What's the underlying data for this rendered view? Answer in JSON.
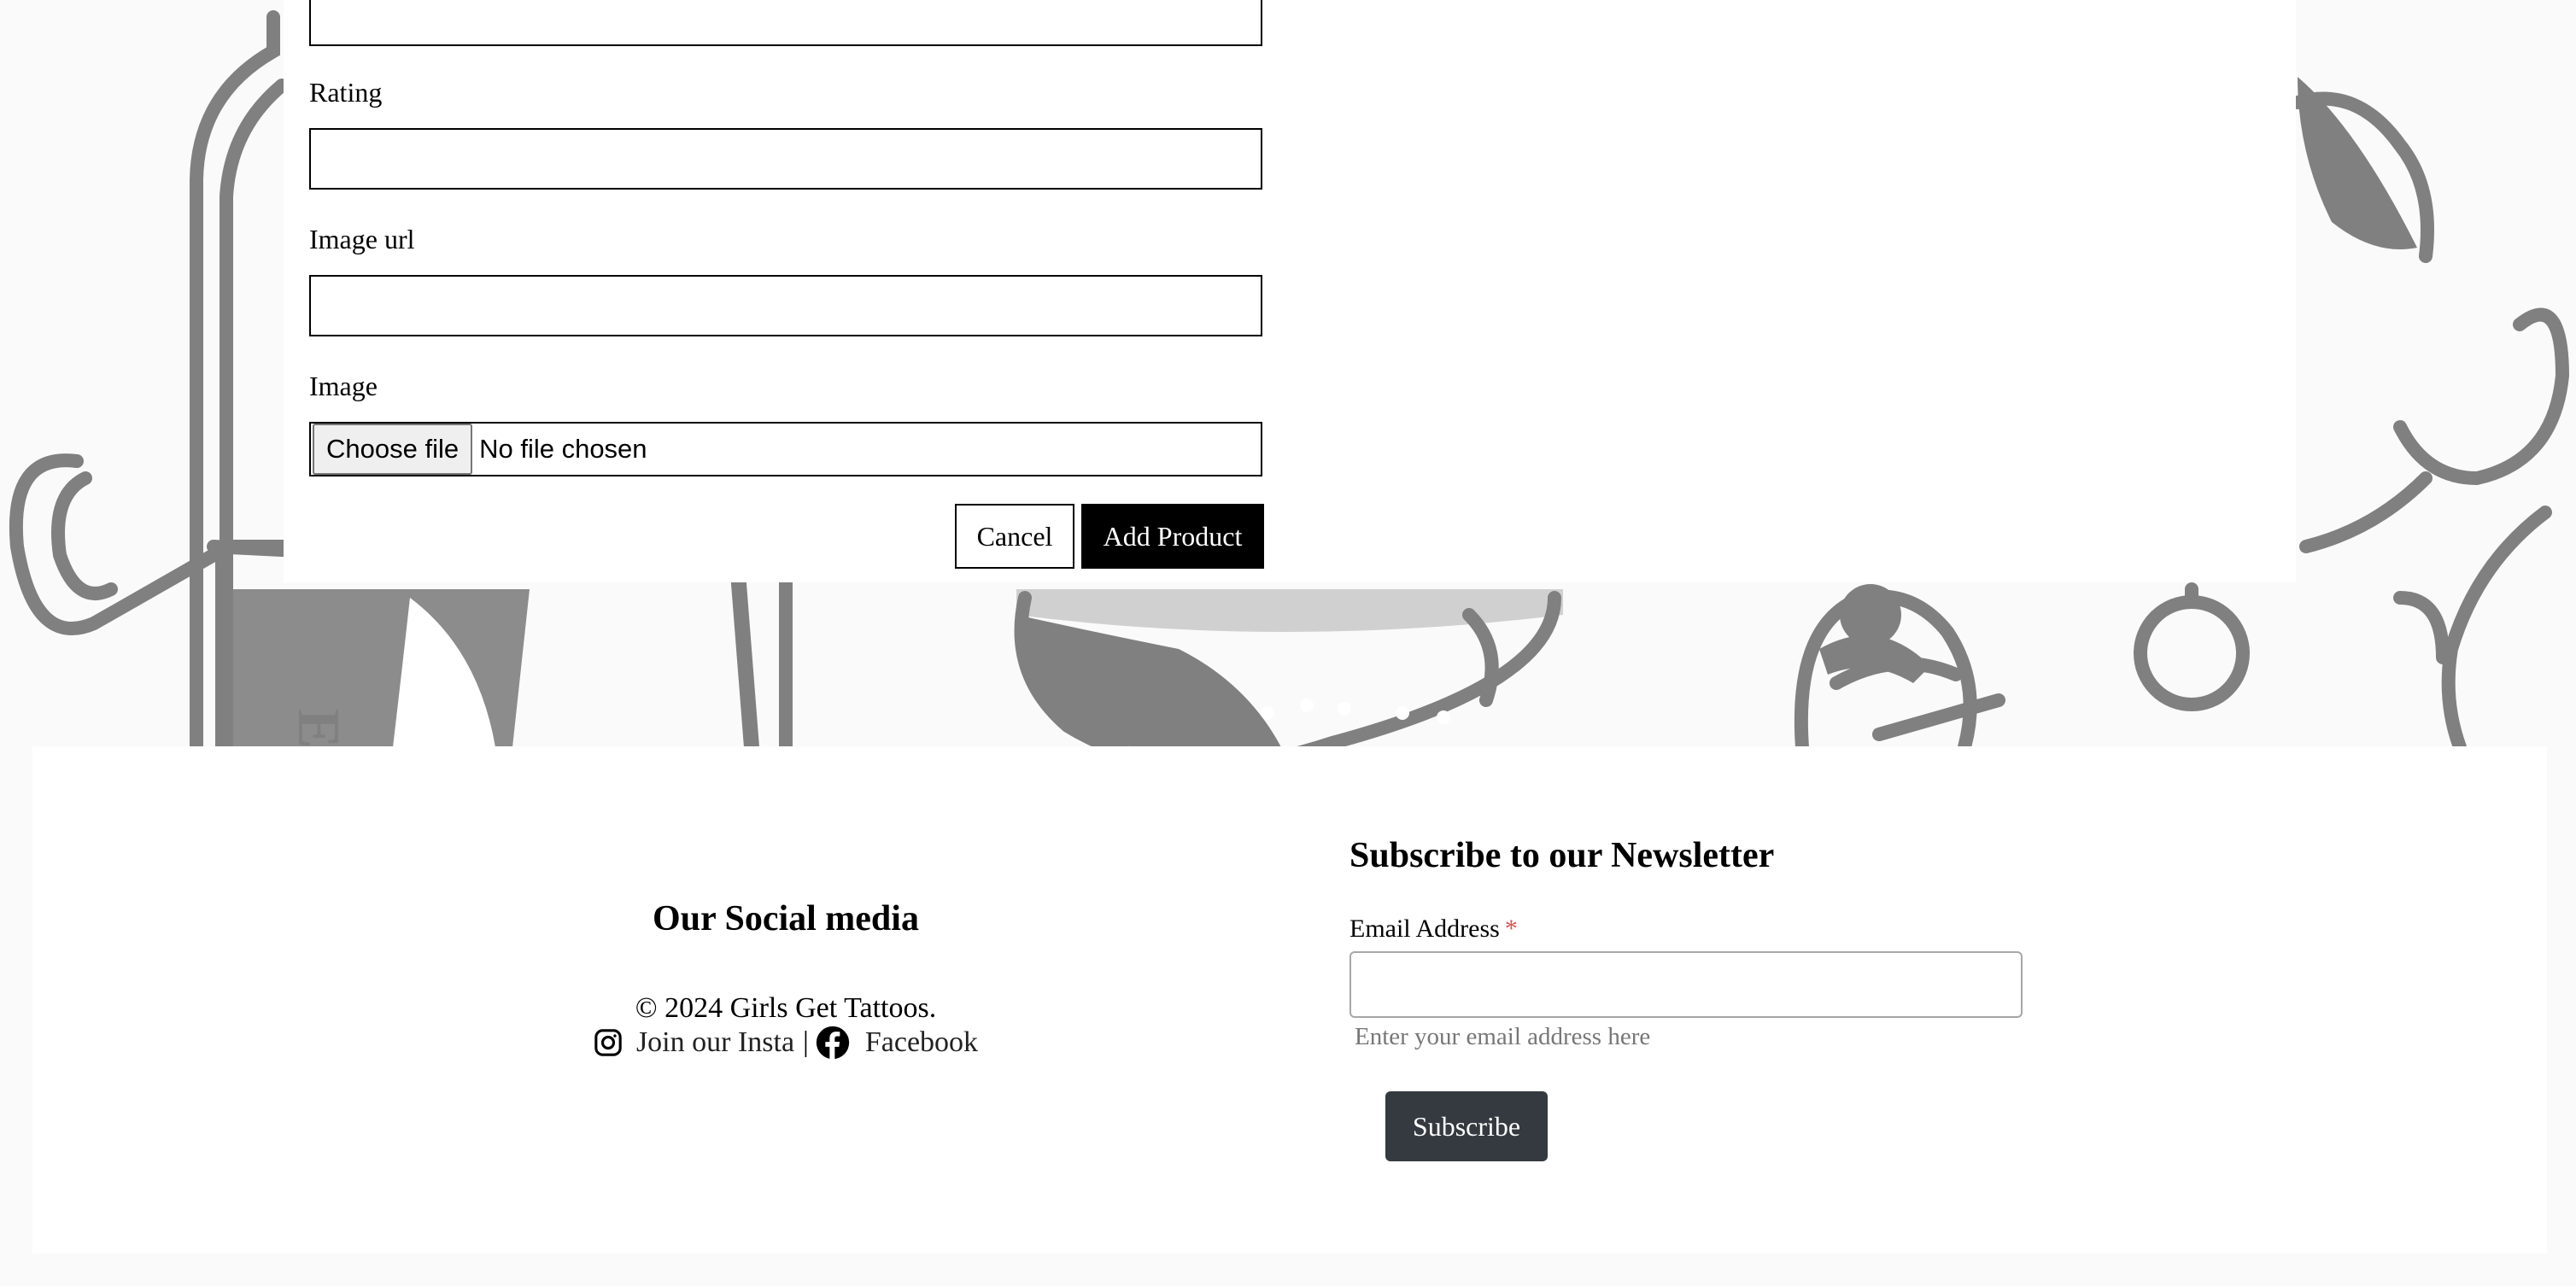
{
  "form": {
    "rating_label": "Rating",
    "image_url_label": "Image url",
    "image_label": "Image",
    "file_button_label": "Choose file",
    "file_status": "No file chosen",
    "cancel_label": "Cancel",
    "submit_label": "Add Product"
  },
  "footer": {
    "social_title": "Our Social media",
    "copyright": "© 2024 Girls Get Tattoos.",
    "instagram_label": "Join our Insta",
    "separator": "|",
    "facebook_label": "Facebook",
    "newsletter_title": "Subscribe to our Newsletter",
    "email_label": "Email Address",
    "required_mark": "*",
    "email_hint": "Enter your email address here",
    "subscribe_label": "Subscribe"
  },
  "icons": {
    "instagram": "instagram-icon",
    "facebook": "facebook-icon"
  },
  "colors": {
    "page_background": "#fafafa",
    "illustration": "#808080",
    "submit_button": "#000000",
    "subscribe_button": "#343a40",
    "required": "#d9534f"
  }
}
